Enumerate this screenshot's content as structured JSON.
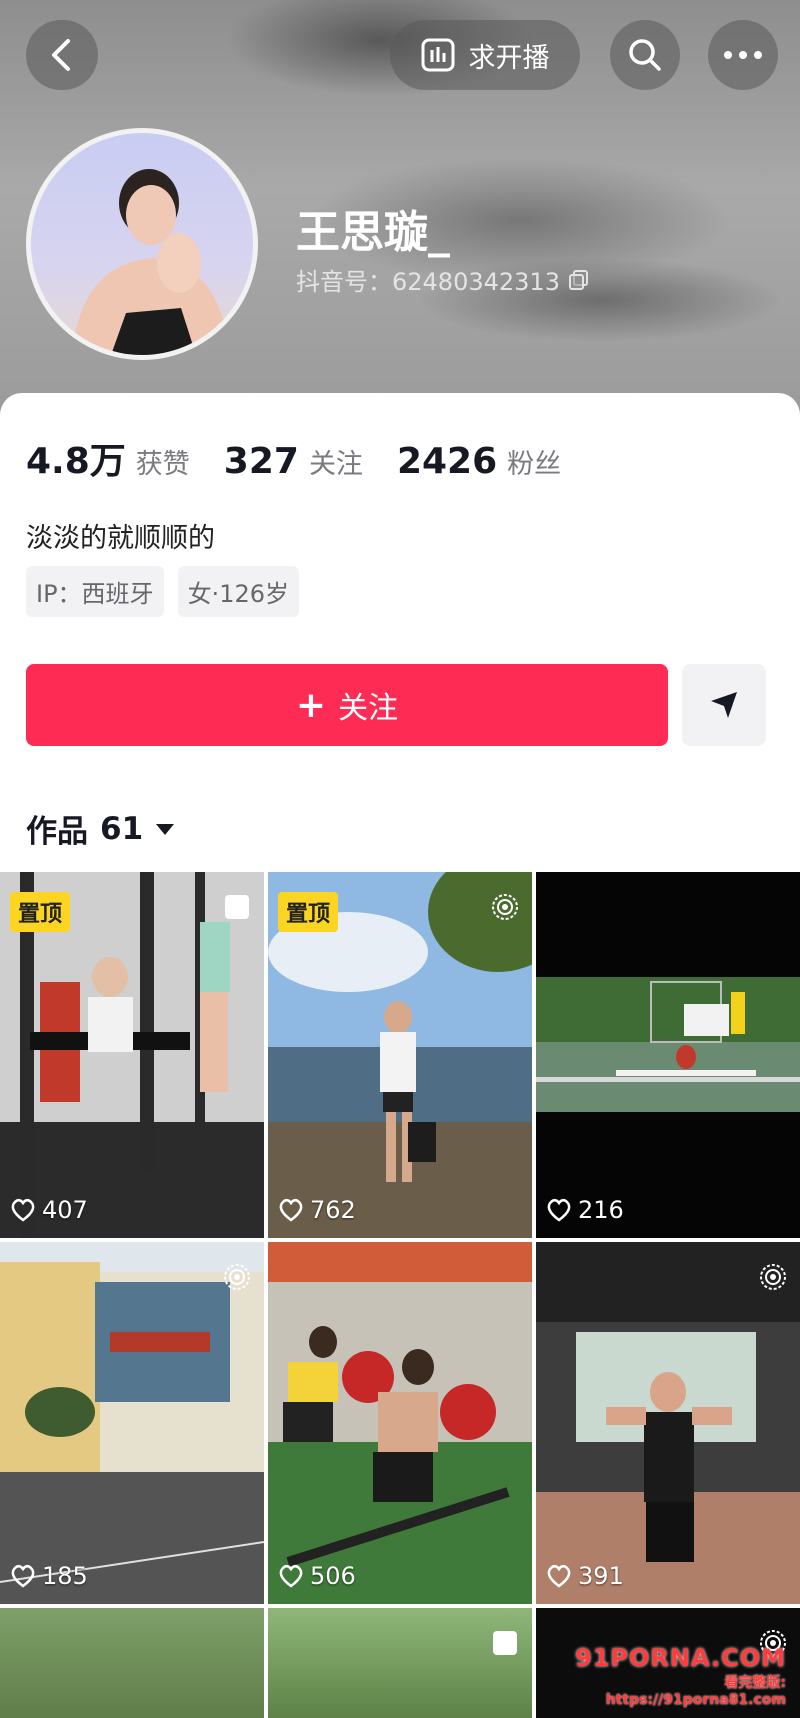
{
  "header": {
    "live_label": "求开播"
  },
  "profile": {
    "username": "王思璇_",
    "douyin_id": "抖音号：62480342313"
  },
  "stats": [
    {
      "value": "4.8万",
      "label": "获赞"
    },
    {
      "value": "327",
      "label": "关注"
    },
    {
      "value": "2426",
      "label": "粉丝"
    }
  ],
  "bio": "淡淡的就顺顺的",
  "tags": [
    "IP：西班牙",
    "女·126岁"
  ],
  "actions": {
    "follow_label": "关注"
  },
  "works": {
    "label": "作品",
    "count": "61"
  },
  "videos": [
    {
      "likes": "407",
      "pinned": "置顶"
    },
    {
      "likes": "762",
      "pinned": "置顶"
    },
    {
      "likes": "216"
    },
    {
      "likes": "185"
    },
    {
      "likes": "506"
    },
    {
      "likes": "391"
    }
  ],
  "watermark": {
    "main": "91PORNA.COM",
    "sub": "看完整版: https://91porna81.com"
  },
  "colors": {
    "accent": "#fe2c55",
    "pin_badge": "#fbd521"
  }
}
